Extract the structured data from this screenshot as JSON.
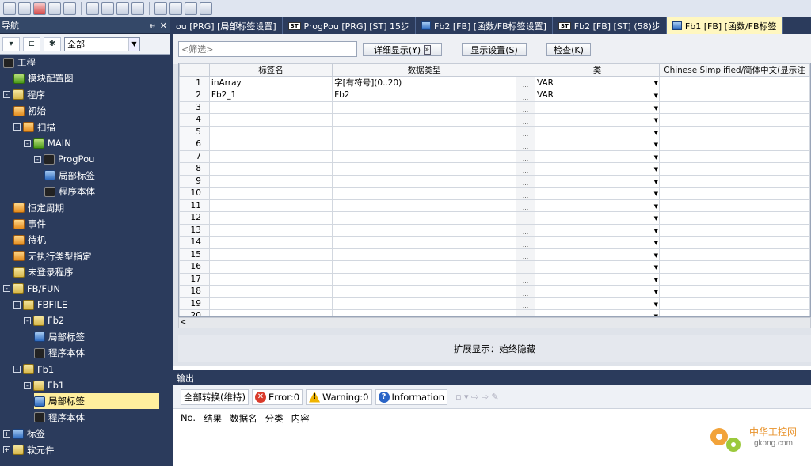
{
  "nav": {
    "title": "导航",
    "pin": "ᵾ",
    "close": "✕",
    "filter_value": "全部",
    "tree": [
      {
        "label": "工程",
        "indent": 0,
        "icon": "dark",
        "exp": ""
      },
      {
        "label": "模块配置图",
        "indent": 1,
        "icon": "green",
        "exp": ""
      },
      {
        "label": "程序",
        "indent": 0,
        "icon": "folder",
        "exp": "-"
      },
      {
        "label": "初始",
        "indent": 1,
        "icon": "orange",
        "exp": ""
      },
      {
        "label": "扫描",
        "indent": 1,
        "icon": "orange",
        "exp": "-"
      },
      {
        "label": "MAIN",
        "indent": 2,
        "icon": "green",
        "exp": "-"
      },
      {
        "label": "ProgPou",
        "indent": 3,
        "icon": "dark",
        "exp": "-"
      },
      {
        "label": "局部标签",
        "indent": 4,
        "icon": "blue",
        "exp": ""
      },
      {
        "label": "程序本体",
        "indent": 4,
        "icon": "dark",
        "exp": ""
      },
      {
        "label": "恒定周期",
        "indent": 1,
        "icon": "orange",
        "exp": ""
      },
      {
        "label": "事件",
        "indent": 1,
        "icon": "orange",
        "exp": ""
      },
      {
        "label": "待机",
        "indent": 1,
        "icon": "orange",
        "exp": ""
      },
      {
        "label": "无执行类型指定",
        "indent": 1,
        "icon": "orange",
        "exp": ""
      },
      {
        "label": "未登录程序",
        "indent": 1,
        "icon": "folder",
        "exp": ""
      },
      {
        "label": "FB/FUN",
        "indent": 0,
        "icon": "folder",
        "exp": "-"
      },
      {
        "label": "FBFILE",
        "indent": 1,
        "icon": "folder",
        "exp": "-"
      },
      {
        "label": "Fb2",
        "indent": 2,
        "icon": "folder",
        "exp": "-"
      },
      {
        "label": "局部标签",
        "indent": 3,
        "icon": "blue",
        "exp": ""
      },
      {
        "label": "程序本体",
        "indent": 3,
        "icon": "dark",
        "exp": ""
      },
      {
        "label": "Fb1",
        "indent": 1,
        "icon": "folder",
        "exp": "-"
      },
      {
        "label": "Fb1",
        "indent": 2,
        "icon": "folder",
        "exp": "-"
      },
      {
        "label": "局部标签",
        "indent": 3,
        "icon": "blue",
        "exp": "",
        "selected": true
      },
      {
        "label": "程序本体",
        "indent": 3,
        "icon": "dark",
        "exp": ""
      },
      {
        "label": "标签",
        "indent": 0,
        "icon": "blue",
        "exp": "+"
      },
      {
        "label": "软元件",
        "indent": 0,
        "icon": "folder",
        "exp": "+"
      }
    ]
  },
  "tabs": [
    {
      "label": "ou [PRG] [局部标签设置]",
      "type": "none"
    },
    {
      "label": "ProgPou [PRG] [ST] 15步",
      "type": "st"
    },
    {
      "label": "Fb2 [FB] [函数/FB标签设置]",
      "type": "tag"
    },
    {
      "label": "Fb2 [FB] [ST] (58)步",
      "type": "st"
    },
    {
      "label": "Fb1 [FB] [函数/FB标签",
      "type": "tag",
      "active": true
    }
  ],
  "editor": {
    "filter_placeholder": "<筛选>",
    "detail_btn": "详细显示(Y)",
    "more_btn": "»",
    "display_settings": "显示设置(S)",
    "check_btn": "检查(K)",
    "columns": [
      "标签名",
      "数据类型",
      "类",
      "Chinese Simplified/简体中文(显示注"
    ],
    "rows": [
      {
        "no": "1",
        "name": "inArray",
        "type": "字[有符号](0..20)",
        "cls": "VAR"
      },
      {
        "no": "2",
        "name": "Fb2_1",
        "type": "Fb2",
        "cls": "VAR"
      },
      {
        "no": "3",
        "name": "",
        "type": "",
        "cls": ""
      },
      {
        "no": "4",
        "name": "",
        "type": "",
        "cls": ""
      },
      {
        "no": "5",
        "name": "",
        "type": "",
        "cls": ""
      },
      {
        "no": "6",
        "name": "",
        "type": "",
        "cls": ""
      },
      {
        "no": "7",
        "name": "",
        "type": "",
        "cls": ""
      },
      {
        "no": "8",
        "name": "",
        "type": "",
        "cls": ""
      },
      {
        "no": "9",
        "name": "",
        "type": "",
        "cls": ""
      },
      {
        "no": "10",
        "name": "",
        "type": "",
        "cls": ""
      },
      {
        "no": "11",
        "name": "",
        "type": "",
        "cls": ""
      },
      {
        "no": "12",
        "name": "",
        "type": "",
        "cls": ""
      },
      {
        "no": "13",
        "name": "",
        "type": "",
        "cls": ""
      },
      {
        "no": "14",
        "name": "",
        "type": "",
        "cls": ""
      },
      {
        "no": "15",
        "name": "",
        "type": "",
        "cls": ""
      },
      {
        "no": "16",
        "name": "",
        "type": "",
        "cls": ""
      },
      {
        "no": "17",
        "name": "",
        "type": "",
        "cls": ""
      },
      {
        "no": "18",
        "name": "",
        "type": "",
        "cls": ""
      },
      {
        "no": "19",
        "name": "",
        "type": "",
        "cls": ""
      },
      {
        "no": "20",
        "name": "",
        "type": "",
        "cls": ""
      }
    ],
    "dots": "...",
    "expand_label": "扩展显示：始终隐藏"
  },
  "output": {
    "title": "输出",
    "convert_label": "全部转换(维持)",
    "error_label": "Error:0",
    "warning_label": "Warning:0",
    "info_label": "Information",
    "columns": [
      "No.",
      "结果",
      "数据名",
      "分类",
      "内容"
    ]
  },
  "watermark": {
    "cn": "中华工控网",
    "en": "gkong.com"
  }
}
